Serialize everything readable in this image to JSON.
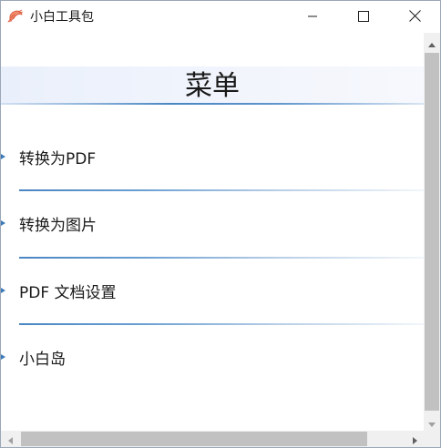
{
  "window": {
    "title": "小白工具包",
    "app_icon": "shrimp-icon",
    "controls": {
      "minimize": "minimize-icon",
      "maximize": "maximize-icon",
      "close": "close-icon"
    }
  },
  "menu": {
    "title": "菜单",
    "items": [
      {
        "label": "转换为PDF"
      },
      {
        "label": "转换为图片"
      },
      {
        "label": "PDF 文档设置"
      },
      {
        "label": "小白岛"
      }
    ]
  },
  "colors": {
    "accent": "#4a86c2",
    "header_bg": "#eef3fb",
    "scroll_thumb": "#c1c1c1",
    "scroll_track": "#f0f0f0",
    "app_icon": "#e0735a"
  }
}
